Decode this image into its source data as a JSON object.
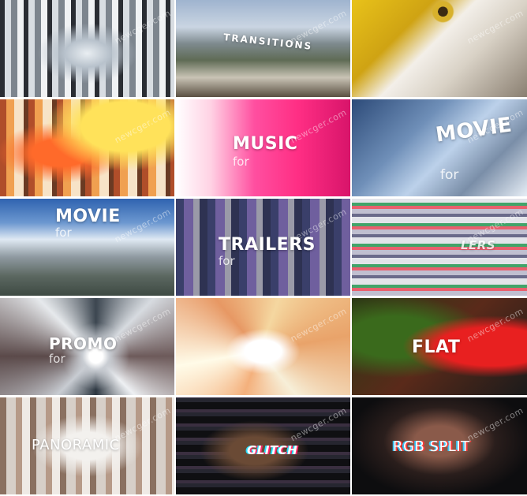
{
  "watermark": "newcger.com",
  "tiles": [
    {
      "title": "",
      "sub": ""
    },
    {
      "title": "TRANSITIONS",
      "sub": ""
    },
    {
      "title": "",
      "sub": ""
    },
    {
      "title": "",
      "sub": ""
    },
    {
      "title": "MUSIC",
      "sub": "for"
    },
    {
      "title": "MOVIE",
      "sub": "for"
    },
    {
      "title": "MOVIE",
      "sub": "for"
    },
    {
      "title": "TRAILERS",
      "sub": "for"
    },
    {
      "title": "LERS",
      "sub": ""
    },
    {
      "title": "PROMO",
      "sub": "for"
    },
    {
      "title": "",
      "sub": ""
    },
    {
      "title": "FLAT",
      "sub": ""
    },
    {
      "title": "PANORAMIC",
      "sub": ""
    },
    {
      "title": "GLITCH",
      "sub": ""
    },
    {
      "title": "RGB SPLIT",
      "sub": ""
    }
  ]
}
